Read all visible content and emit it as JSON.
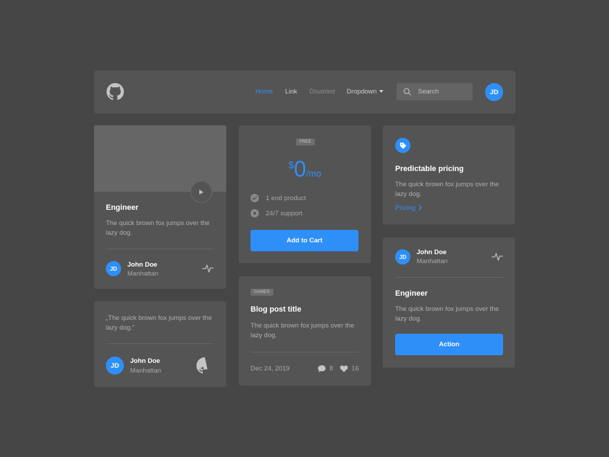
{
  "navbar": {
    "logo_icon": "github-icon",
    "links": [
      "Home",
      "Link",
      "Disabled",
      "Dropdown"
    ],
    "search_placeholder": "Search",
    "avatar_initials": "JD"
  },
  "profile_card": {
    "role": "Engineer",
    "description": "The quick brown fox jumps over the lazy dog.",
    "user_name": "John Doe",
    "user_location": "Manhattan",
    "avatar_initials": "JD"
  },
  "quote_card": {
    "quote": "„The quick brown fox jumps over the lazy dog.\"",
    "user_name": "John Doe",
    "user_location": "Manhattan",
    "avatar_initials": "JD"
  },
  "pricing_card": {
    "badge": "FREE",
    "currency": "$",
    "price": "0",
    "period": "/mo",
    "features": [
      "1 end product",
      "24/7 support"
    ],
    "button_label": "Add to Cart"
  },
  "blog_card": {
    "badge": "GAMES",
    "title": "Blog post title",
    "description": "The quick brown fox jumps over the lazy dog.",
    "date": "Dec 24, 2019",
    "comments": "8",
    "likes": "16"
  },
  "feature_card": {
    "title": "Predictable pricing",
    "description": "The quick brown fox jumps over the lazy dog.",
    "link_label": "Pricing"
  },
  "action_card": {
    "user_name": "John Doe",
    "user_location": "Manhattan",
    "avatar_initials": "JD",
    "role": "Engineer",
    "description": "The quick brown fox jumps over the lazy dog.",
    "button_label": "Action"
  },
  "colors": {
    "background": "#464646",
    "panel": "#545454",
    "accent": "#2f8ff8"
  }
}
